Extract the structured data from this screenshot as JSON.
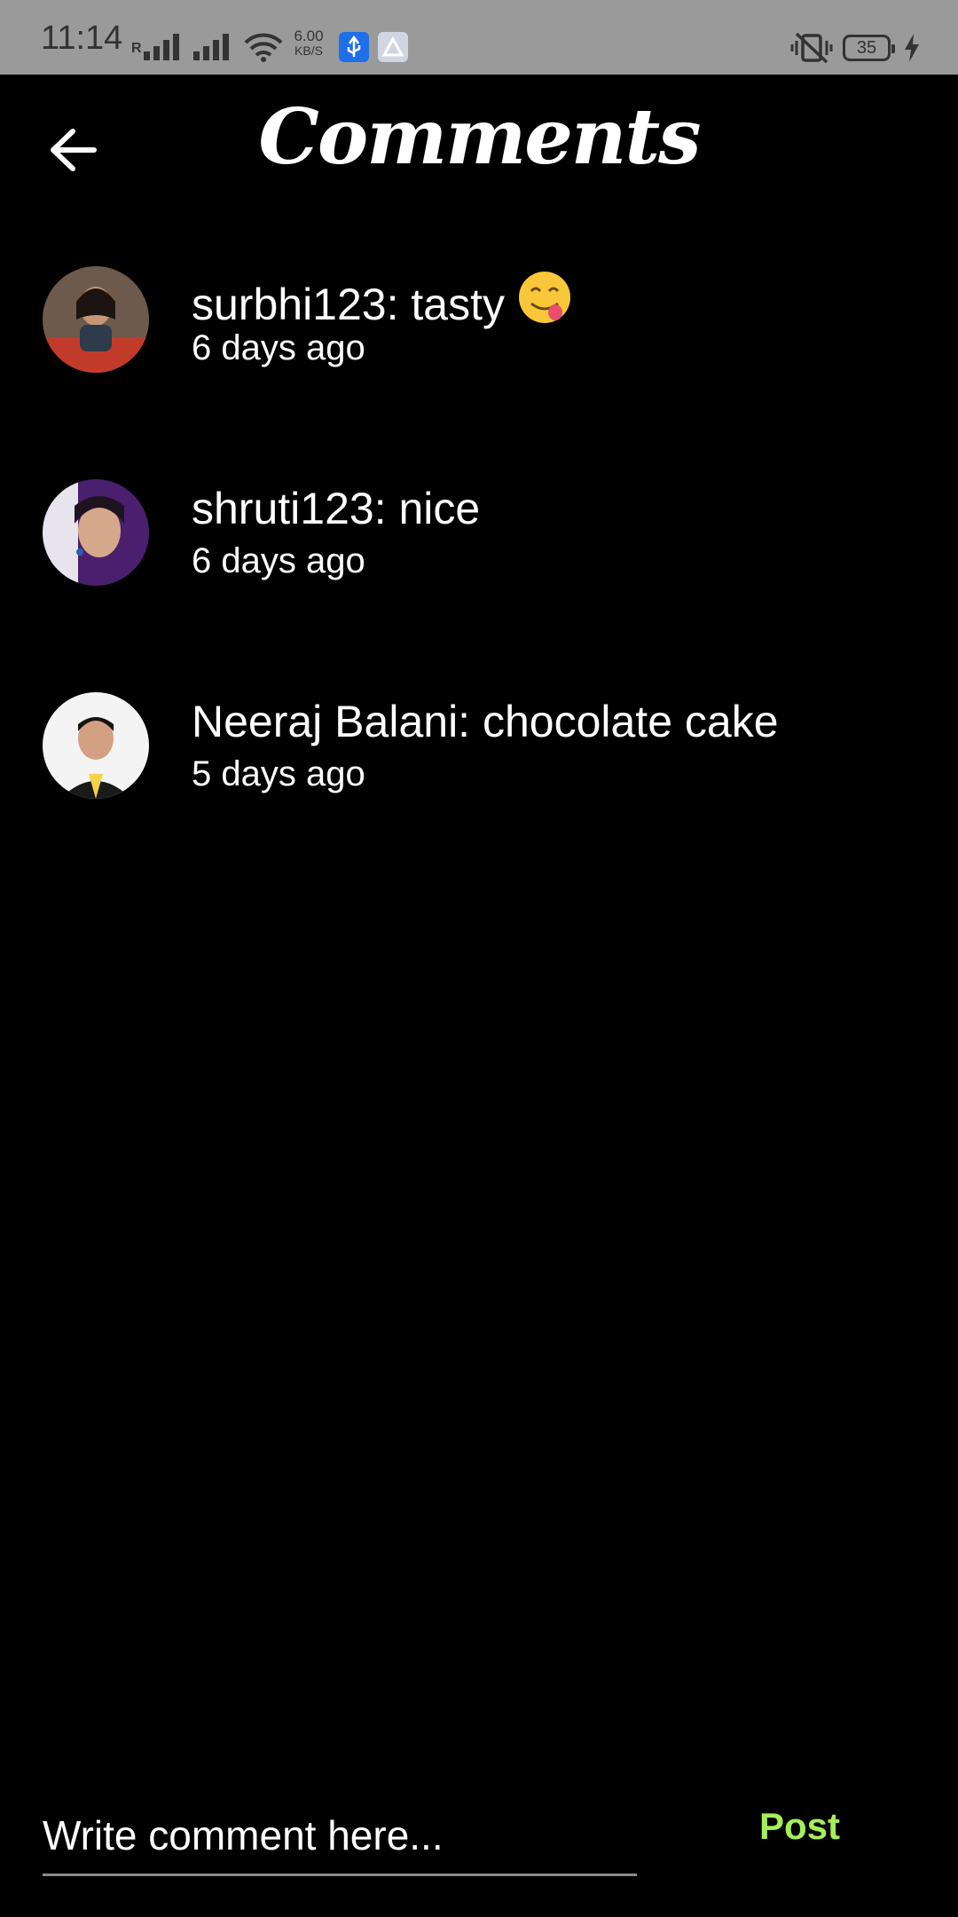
{
  "status_bar": {
    "time": "11:14",
    "roaming": "R",
    "net_speed_value": "6.00",
    "net_speed_unit": "KB/S",
    "battery": "35"
  },
  "header": {
    "title": "Comments",
    "back_icon": "arrow-left-icon"
  },
  "comments": [
    {
      "user": "surbhi123",
      "text": "tasty",
      "emoji": "face-savoring-food",
      "time": "6 days ago"
    },
    {
      "user": "shruti123",
      "text": "nice",
      "time": "6 days ago"
    },
    {
      "user": "Neeraj Balani",
      "text": "chocolate cake",
      "time": "5 days ago"
    }
  ],
  "composer": {
    "placeholder": "Write comment here...",
    "post_label": "Post"
  },
  "colors": {
    "background": "#000000",
    "status_bar": "#9a9a9a",
    "post_accent": "#a6ee5a"
  }
}
